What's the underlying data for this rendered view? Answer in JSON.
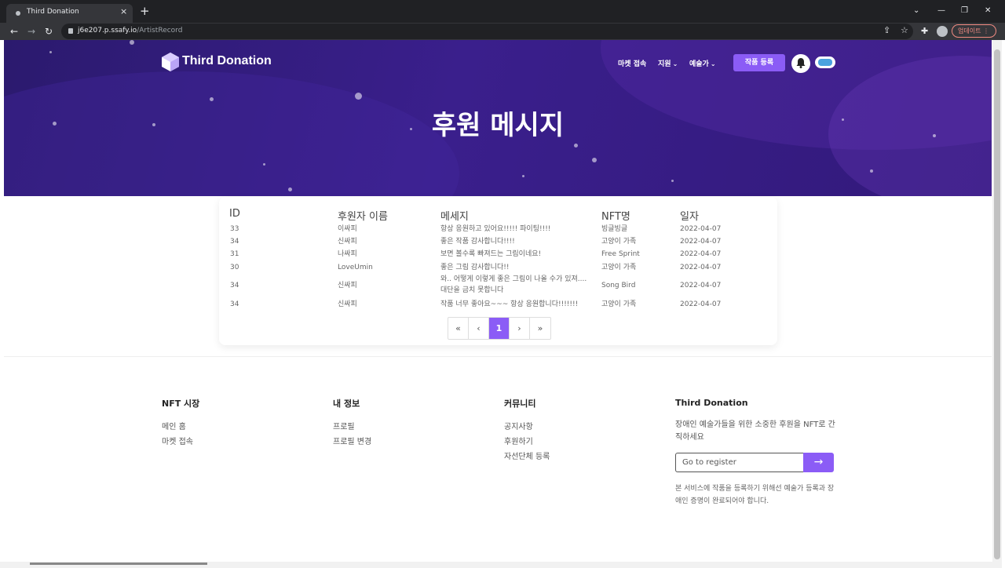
{
  "browser": {
    "tab_title": "Third Donation",
    "new_tab": "+",
    "tab_close": "×",
    "url_host": "j6e207.p.ssafy.io",
    "url_path": "/ArtistRecord",
    "update_label": "업데이트"
  },
  "header": {
    "brand": "Third Donation",
    "nav": {
      "market": "마켓 접속",
      "support": "지원",
      "artist": "예술가"
    },
    "register_button": "작품 등록"
  },
  "hero": {
    "title": "후원 메시지"
  },
  "table": {
    "columns": [
      "ID",
      "후원자 이름",
      "메세지",
      "NFT명",
      "일자"
    ],
    "rows": [
      {
        "id": "33",
        "name": "이싸피",
        "message": "항상 응원하고 있어요!!!!! 파이팅!!!!",
        "nft": "빙글빙글",
        "date": "2022-04-07"
      },
      {
        "id": "34",
        "name": "신싸피",
        "message": "좋은 작품 감사합니다!!!!",
        "nft": "고양이 가족",
        "date": "2022-04-07"
      },
      {
        "id": "31",
        "name": "나싸피",
        "message": "보면 볼수록 빠져드는 그림이네요!",
        "nft": "Free Sprint",
        "date": "2022-04-07"
      },
      {
        "id": "30",
        "name": "LoveUmin",
        "message": "좋은 그림 감사합니다!!",
        "nft": "고양이 가족",
        "date": "2022-04-07"
      },
      {
        "id": "34",
        "name": "신싸피",
        "message": "와.. 어떻게 이렇게 좋은 그림이 나올 수가 있져.... 대단을 금치 못합니다",
        "nft": "Song Bird",
        "date": "2022-04-07"
      },
      {
        "id": "34",
        "name": "신싸피",
        "message": "작품 너무 좋아요~~~ 항상 응원합니다!!!!!!!",
        "nft": "고양이 가족",
        "date": "2022-04-07"
      }
    ]
  },
  "pagination": {
    "first": "«",
    "prev": "‹",
    "current": "1",
    "next": "›",
    "last": "»"
  },
  "footer": {
    "nft_market": {
      "title": "NFT 시장",
      "links": [
        "메인 홈",
        "마켓 접속"
      ]
    },
    "my_info": {
      "title": "내 정보",
      "links": [
        "프로필",
        "프로필 변경"
      ]
    },
    "community": {
      "title": "커뮤니티",
      "links": [
        "공지사항",
        "후원하기",
        "자선단체 등록"
      ]
    },
    "third_donation": {
      "title": "Third Donation",
      "description": "장애인 예술가들을 위한 소중한 후원을 NFT로 간직하세요",
      "register_placeholder": "Go to register",
      "register_arrow": "→",
      "note": "본 서비스에 작품을 등록하기 위해선 예술가 등록과 장애인 증명이 완료되어야 합니다."
    }
  },
  "colors": {
    "accent": "#8b5cf6",
    "hero_dark": "#2b1a6e",
    "hero_mid": "#3a1f8c"
  }
}
